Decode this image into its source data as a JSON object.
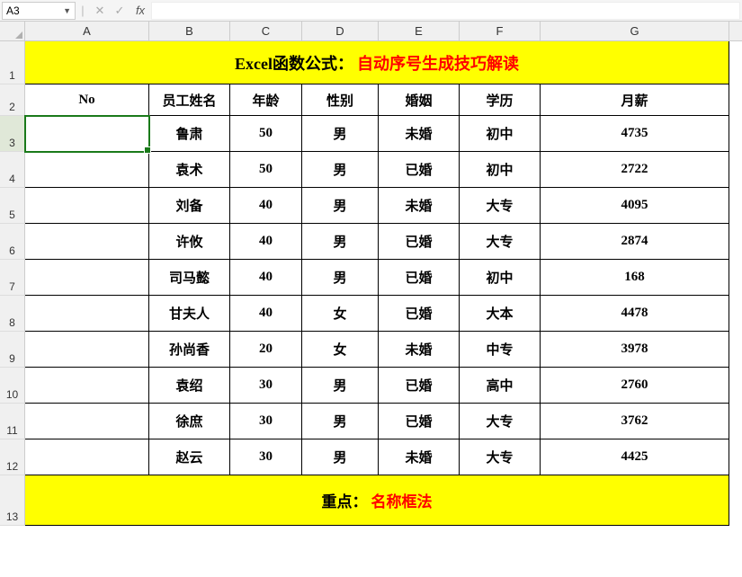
{
  "nameBox": "A3",
  "columns": [
    "A",
    "B",
    "C",
    "D",
    "E",
    "F",
    "G"
  ],
  "rowNumbers": [
    1,
    2,
    3,
    4,
    5,
    6,
    7,
    8,
    9,
    10,
    11,
    12,
    13
  ],
  "selectedRow": 3,
  "titlePrefix": "Excel函数公式：",
  "titleSuffix": "自动序号生成技巧解读",
  "headers": {
    "no": "No",
    "name": "员工姓名",
    "age": "年龄",
    "gender": "性别",
    "marriage": "婚姻",
    "edu": "学历",
    "salary": "月薪"
  },
  "rows": [
    {
      "no": "",
      "name": "鲁肃",
      "age": "50",
      "gender": "男",
      "marriage": "未婚",
      "edu": "初中",
      "salary": "4735"
    },
    {
      "no": "",
      "name": "袁术",
      "age": "50",
      "gender": "男",
      "marriage": "已婚",
      "edu": "初中",
      "salary": "2722"
    },
    {
      "no": "",
      "name": "刘备",
      "age": "40",
      "gender": "男",
      "marriage": "未婚",
      "edu": "大专",
      "salary": "4095"
    },
    {
      "no": "",
      "name": "许攸",
      "age": "40",
      "gender": "男",
      "marriage": "已婚",
      "edu": "大专",
      "salary": "2874"
    },
    {
      "no": "",
      "name": "司马懿",
      "age": "40",
      "gender": "男",
      "marriage": "已婚",
      "edu": "初中",
      "salary": "168"
    },
    {
      "no": "",
      "name": "甘夫人",
      "age": "40",
      "gender": "女",
      "marriage": "已婚",
      "edu": "大本",
      "salary": "4478"
    },
    {
      "no": "",
      "name": "孙尚香",
      "age": "20",
      "gender": "女",
      "marriage": "未婚",
      "edu": "中专",
      "salary": "3978"
    },
    {
      "no": "",
      "name": "袁绍",
      "age": "30",
      "gender": "男",
      "marriage": "已婚",
      "edu": "高中",
      "salary": "2760"
    },
    {
      "no": "",
      "name": "徐庶",
      "age": "30",
      "gender": "男",
      "marriage": "已婚",
      "edu": "大专",
      "salary": "3762"
    },
    {
      "no": "",
      "name": "赵云",
      "age": "30",
      "gender": "男",
      "marriage": "未婚",
      "edu": "大专",
      "salary": "4425"
    }
  ],
  "footerPrefix": "重点：",
  "footerSuffix": "名称框法",
  "rowHeights": {
    "title": 48,
    "header": 35,
    "data": 40,
    "footer": 56
  }
}
